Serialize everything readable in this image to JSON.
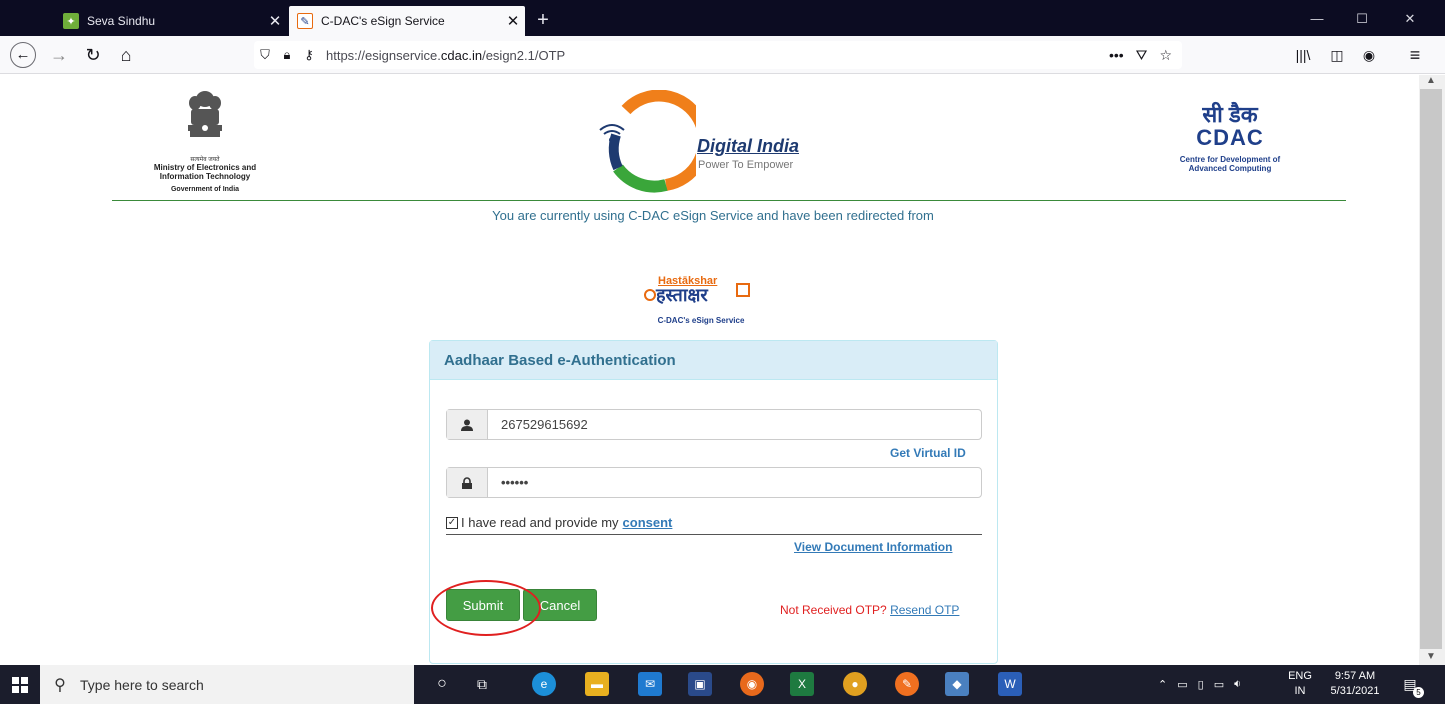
{
  "browser": {
    "tabs": [
      {
        "title": "Seva Sindhu",
        "active": false
      },
      {
        "title": "C-DAC's eSign Service",
        "active": true
      }
    ],
    "url_prefix": "https://esignservice.",
    "url_domain": "cdac.in",
    "url_path": "/esign2.1/OTP"
  },
  "header": {
    "meity_hindi": "सत्यमेव जयते",
    "meity_line1": "Ministry of Electronics and",
    "meity_line2": "Information Technology",
    "meity_line3": "Government of India",
    "digital_india_title": "Digital India",
    "digital_india_sub": "Power To Empower",
    "cdac_hindi": "सी डैक",
    "cdac_short": "CDAC",
    "cdac_full1": "Centre for Development of",
    "cdac_full2": "Advanced Computing"
  },
  "notice": "You are currently using C-DAC eSign Service and have been redirected from",
  "hastakshar": {
    "english": "Hastākshar",
    "hindi": "हस्ताक्षर",
    "caption": "C-DAC's eSign Service"
  },
  "form": {
    "heading": "Aadhaar Based e-Authentication",
    "aadhaar_value": "267529615692",
    "virtual_id_link": "Get Virtual ID",
    "otp_value": "••••••",
    "consent_text": "I have read and provide my",
    "consent_link": "consent",
    "consent_checked": true,
    "view_doc_link": "View Document Information",
    "submit_label": "Submit",
    "cancel_label": "Cancel",
    "not_received": "Not Received OTP?",
    "resend_link": "Resend OTP"
  },
  "taskbar": {
    "search_placeholder": "Type here to search",
    "lang_top": "ENG",
    "lang_bottom": "IN",
    "time": "9:57 AM",
    "date": "5/31/2021",
    "notification_count": "5"
  },
  "colors": {
    "accent_blue": "#31708f",
    "button_green": "#449d44",
    "highlight_red": "#e02020"
  }
}
